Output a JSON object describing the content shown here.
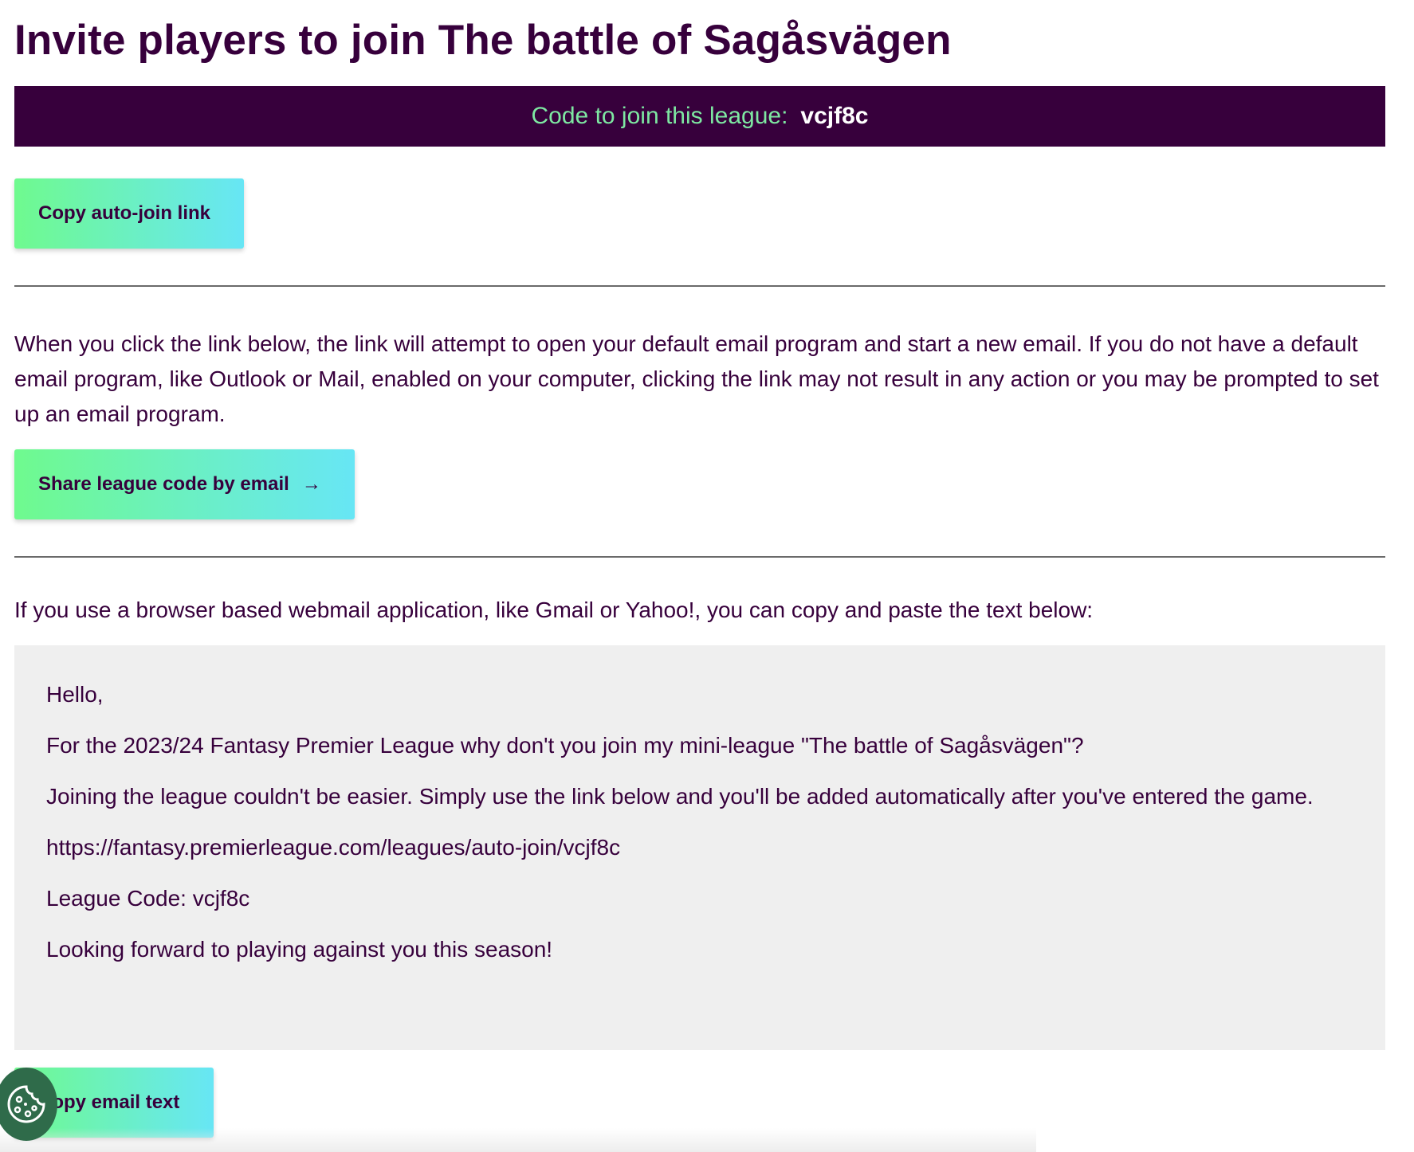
{
  "page": {
    "title": "Invite players to join The battle of Sagåsvägen"
  },
  "code_banner": {
    "label": "Code to join this league:",
    "code": "vcjf8c"
  },
  "buttons": {
    "copy_auto_join": "Copy auto-join link",
    "share_by_email": "Share league code by email",
    "share_arrow": "→",
    "copy_email_text": "Copy email text"
  },
  "info": {
    "email_program_notice": "When you click the link below, the link will attempt to open your default email program and start a new email. If you do not have a default email program, like Outlook or Mail, enabled on your computer, clicking the link may not result in any action or you may be prompted to set up an email program.",
    "webmail_notice": "If you use a browser based webmail application, like Gmail or Yahoo!, you can copy and paste the text below:"
  },
  "email_body": {
    "greeting": "Hello,",
    "invite_line": "For the 2023/24 Fantasy Premier League why don't you join my mini-league \"The battle of Sagåsvägen\"?",
    "joining_line": "Joining the league couldn't be easier. Simply use the link below and you'll be added automatically after you've entered the game.",
    "link": "https://fantasy.premierleague.com/leagues/auto-join/vcjf8c",
    "league_code_line": "League Code: vcjf8c",
    "closing": "Looking forward to playing against you this season!"
  },
  "icons": {
    "cookie": "cookie-icon",
    "arrow": "arrow-right-icon"
  },
  "colors": {
    "brand_purple": "#37003c",
    "accent_green": "#6ffa8e",
    "accent_cyan": "#67e6f5",
    "code_label_green": "#7ee8a2",
    "email_box_bg": "#efefef",
    "cookie_button_bg": "#2f6b4a"
  }
}
